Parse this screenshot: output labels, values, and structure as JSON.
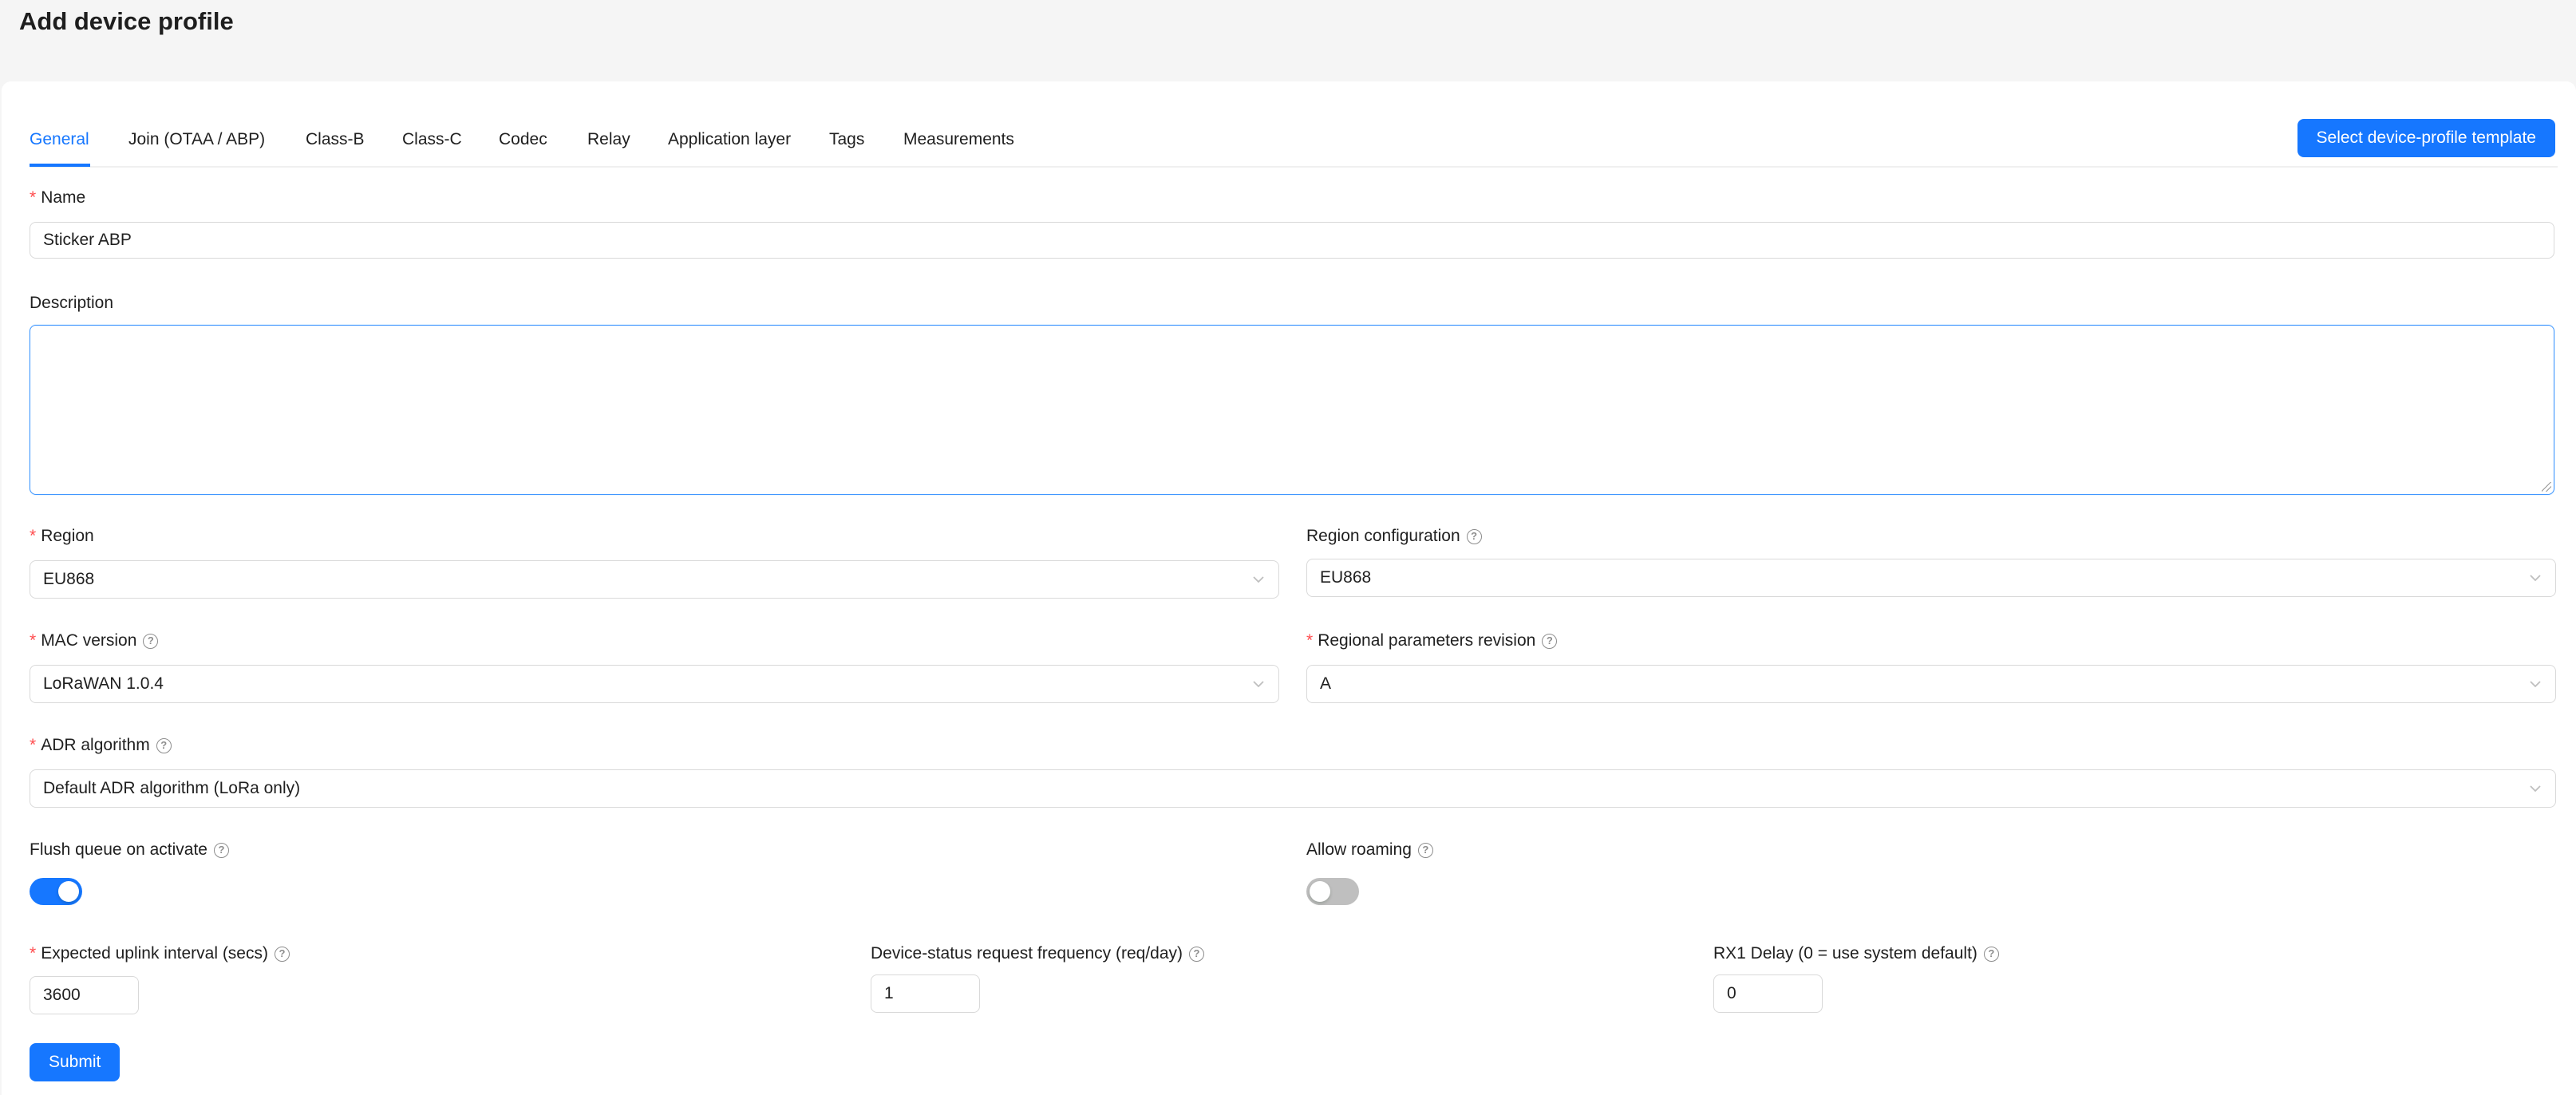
{
  "page": {
    "title": "Add device profile"
  },
  "tabs": [
    {
      "label": "General",
      "active": true
    },
    {
      "label": "Join (OTAA / ABP)"
    },
    {
      "label": "Class-B"
    },
    {
      "label": "Class-C"
    },
    {
      "label": "Codec"
    },
    {
      "label": "Relay"
    },
    {
      "label": "Application layer"
    },
    {
      "label": "Tags"
    },
    {
      "label": "Measurements"
    }
  ],
  "template_button": "Select device-profile template",
  "form": {
    "name": {
      "label": "Name",
      "required": true,
      "value": "Sticker ABP"
    },
    "description": {
      "label": "Description",
      "value": ""
    },
    "region": {
      "label": "Region",
      "required": true,
      "value": "EU868"
    },
    "region_configuration": {
      "label": "Region configuration",
      "value": "EU868"
    },
    "mac_version": {
      "label": "MAC version",
      "required": true,
      "value": "LoRaWAN 1.0.4"
    },
    "regional_parameters_revision": {
      "label": "Regional parameters revision",
      "required": true,
      "value": "A"
    },
    "adr_algorithm": {
      "label": "ADR algorithm",
      "required": true,
      "value": "Default ADR algorithm (LoRa only)"
    },
    "flush_queue": {
      "label": "Flush queue on activate",
      "enabled": true
    },
    "allow_roaming": {
      "label": "Allow roaming",
      "enabled": false
    },
    "uplink_interval": {
      "label": "Expected uplink interval (secs)",
      "required": true,
      "value": "3600"
    },
    "device_status_freq": {
      "label": "Device-status request frequency (req/day)",
      "value": "1"
    },
    "rx1_delay": {
      "label": "RX1 Delay (0 = use system default)",
      "value": "0"
    }
  },
  "submit_label": "Submit",
  "colors": {
    "primary": "#1677ff",
    "required": "#ff4d4f",
    "border": "#d9d9d9",
    "background": "#f5f5f5"
  }
}
